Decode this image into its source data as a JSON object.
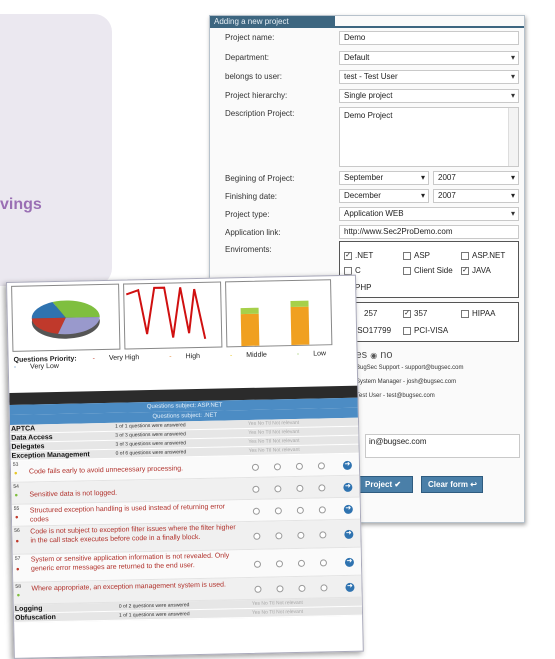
{
  "background": {
    "side_text": "vings"
  },
  "form": {
    "header": "Adding a new project",
    "fields": [
      {
        "label": "Project name:",
        "value": "Demo"
      },
      {
        "label": "Department:",
        "value": "Default"
      },
      {
        "label": "belongs to user:",
        "value": "test - Test User"
      },
      {
        "label": "Project hierarchy:",
        "value": "Single project"
      },
      {
        "label": "Description Project:",
        "value": "Demo Project"
      },
      {
        "label": "Begining of Project:",
        "month": "September",
        "year": "2007"
      },
      {
        "label": "Finishing date:",
        "month": "December",
        "year": "2007"
      },
      {
        "label": "Project type:",
        "value": "Application WEB"
      },
      {
        "label": "Application link:",
        "value": "http://www.Sec2ProDemo.com"
      },
      {
        "label": "Enviroments:"
      }
    ],
    "environments": [
      {
        "label": ".NET",
        "checked": true
      },
      {
        "label": "ASP",
        "checked": false
      },
      {
        "label": "ASP.NET",
        "checked": false
      },
      {
        "label": "C",
        "checked": false
      },
      {
        "label": "Client Side",
        "checked": false
      },
      {
        "label": "JAVA",
        "checked": true
      },
      {
        "label": "PHP",
        "checked": false
      }
    ],
    "standards": [
      {
        "label": "257",
        "checked": false
      },
      {
        "label": "357",
        "checked": true
      },
      {
        "label": "HIPAA",
        "checked": false
      },
      {
        "label": "ISO17799",
        "checked": false
      },
      {
        "label": "PCI-VISA",
        "checked": false
      }
    ],
    "yes_no": {
      "yes": "yes",
      "no": "no"
    },
    "contacts": [
      "BugSec Support - support@bugsec.com",
      "System Manager - josh@bugsec.com",
      "Test User - test@bugsec.com"
    ],
    "email_value": "in@bugsec.com",
    "add_button": "Project",
    "clear_button": "Clear form"
  },
  "questions": {
    "legend_title": "Questions Priority:",
    "legend_items": [
      "Very High",
      "High",
      "Middle",
      "Low",
      "Very Low"
    ],
    "legend_colors": [
      "#c0392b",
      "#e07b22",
      "#e8c82a",
      "#7fbf3f",
      "#2f73b0"
    ],
    "subjects": [
      "Questions subject: ASP.NET",
      "Questions subject: .NET"
    ],
    "groups_top": [
      {
        "name": "APTCA",
        "count": "1 of 1 questions were answered"
      },
      {
        "name": "Data Access",
        "count": "3 of 3 questions were answered"
      },
      {
        "name": "Delegates",
        "count": "3 of 3 questions were answered"
      },
      {
        "name": "Exception Management",
        "count": "0 of 6 questions were answered"
      }
    ],
    "yn_header": "Yes  No  Ttl Not relevant",
    "items": [
      {
        "num": "53",
        "text": "Code fails early to avoid unnecessary processing."
      },
      {
        "num": "54",
        "text": "Sensitive data is not logged."
      },
      {
        "num": "55",
        "text": "Structured exception handling is used instead of returning error codes"
      },
      {
        "num": "56",
        "text": "Code is not subject to exception filter issues where the filter higher in the call stack executes before code in a finally block."
      },
      {
        "num": "57",
        "text": "System or sensitive application information is not revealed. Only generic error messages are returned to the end user."
      },
      {
        "num": "58",
        "text": "Where appropriate, an exception management system is used."
      }
    ],
    "groups_bottom": [
      {
        "name": "Logging",
        "count": "0 of 2 questions were answered"
      },
      {
        "name": "Obfuscation",
        "count": "1 of 1 questions were answered"
      }
    ],
    "go_glyph": "➜"
  }
}
